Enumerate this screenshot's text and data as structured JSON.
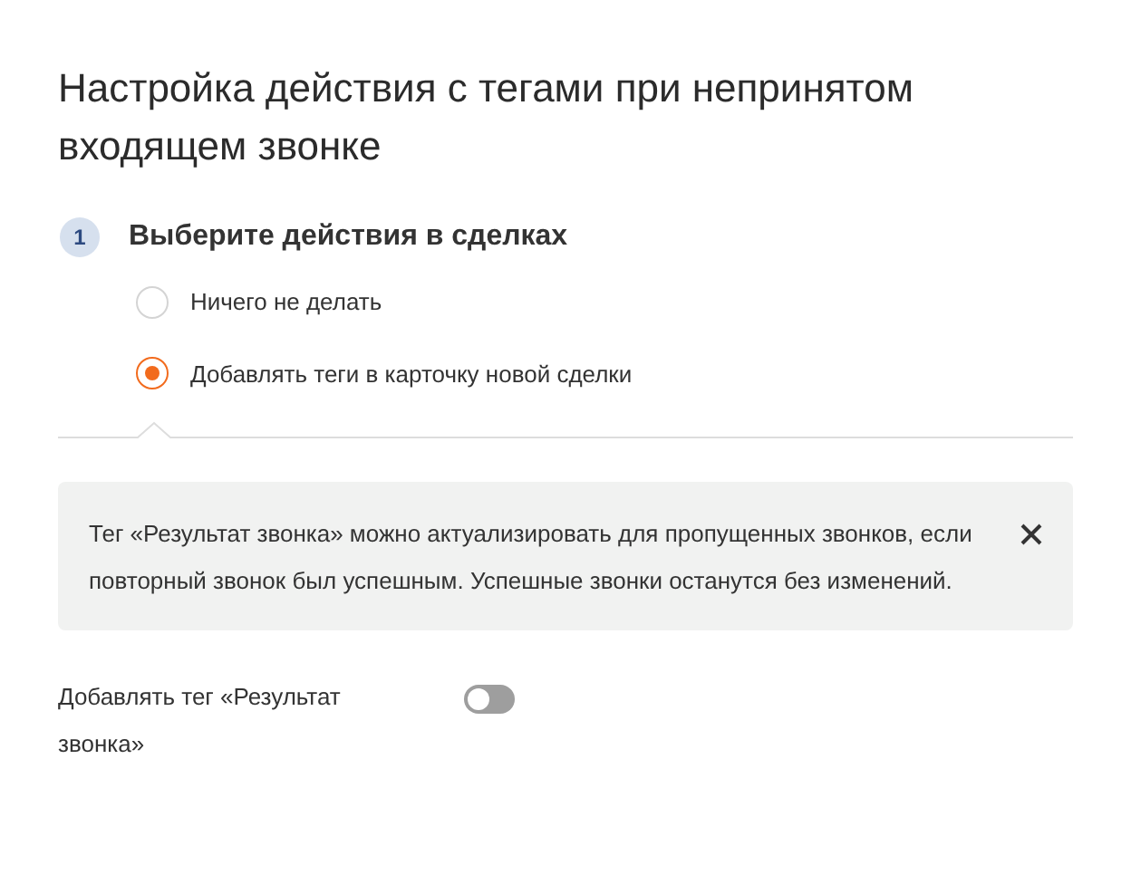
{
  "title": "Настройка действия с тегами при непринятом входящем звонке",
  "step": {
    "number": "1",
    "title": "Выберите действия в сделках"
  },
  "options": [
    {
      "label": "Ничего не делать",
      "selected": false
    },
    {
      "label": "Добавлять теги в карточку новой сделки",
      "selected": true
    }
  ],
  "info": {
    "text": "Тег «Результат звонка» можно актуализировать для пропущенных звонков, если повторный звонок был успешным. Успешные звонки останутся без изменений."
  },
  "toggle": {
    "label": "Добавлять тег «Результат звонка»",
    "on": false
  }
}
